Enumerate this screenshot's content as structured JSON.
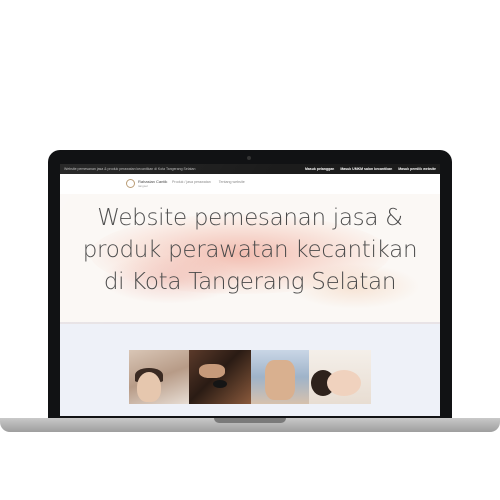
{
  "topbar": {
    "tagline": "Website pemesanan jasa & produk perawatan kecantikan di Kota Tangerang Selatan",
    "links": [
      "Masuk pelanggan",
      "Masuk UMKM salon kecantikan",
      "Masuk pemilik website"
    ]
  },
  "navbar": {
    "logo_text": "Rahasian Cantik",
    "logo_sub": "tangsel",
    "links": [
      "Produk / jasa perawatan",
      "Tentang website"
    ]
  },
  "hero": {
    "title": "Website pemesanan jasa & produk perawatan kecantikan di Kota Tangerang Selatan"
  },
  "colors": {
    "accent": "#e58a78",
    "bezel": "#111214",
    "topbar": "#1c1c1c"
  }
}
